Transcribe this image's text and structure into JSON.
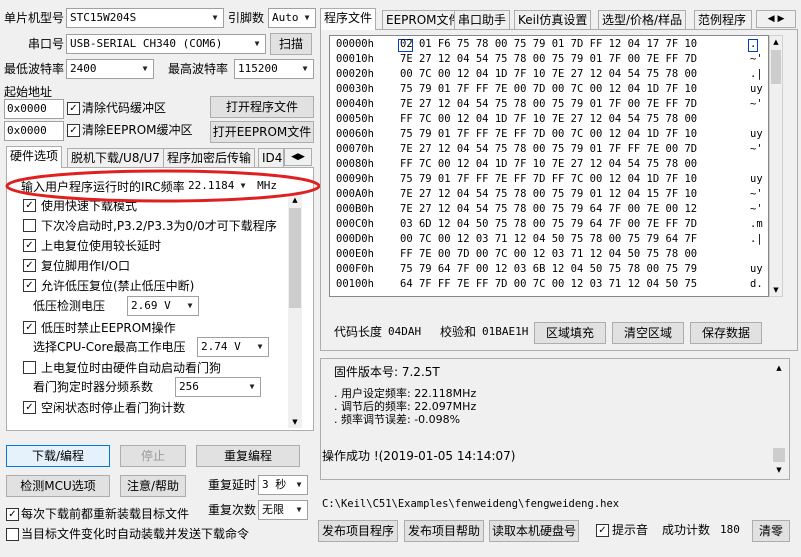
{
  "top": {
    "mcu_label": "单片机型号",
    "mcu_value": "STC15W204S",
    "pins_label": "引脚数",
    "pins_value": "Auto",
    "port_label": "串口号",
    "port_value": "USB-SERIAL CH340 (COM6)",
    "scan_button": "扫描",
    "min_baud_label": "最低波特率",
    "min_baud_value": "2400",
    "max_baud_label": "最高波特率",
    "max_baud_value": "115200",
    "start_addr_label": "起始地址",
    "addr1": "0x0000",
    "clear_code_label": "清除代码缓冲区",
    "open_prog_button": "打开程序文件",
    "addr2": "0x0000",
    "clear_eeprom_label": "清除EEPROM缓冲区",
    "open_eeprom_button": "打开EEPROM文件"
  },
  "left_tabs": [
    "硬件选项",
    "脱机下载/U8/U7",
    "程序加密后传输",
    "ID4"
  ],
  "hw": {
    "irc_label": "输入用户程序运行时的IRC频率",
    "irc_value": "22.1184",
    "irc_unit": "MHz",
    "options": [
      {
        "label": "使用快速下载模式",
        "checked": true
      },
      {
        "label": "下次冷启动时,P3.2/P3.3为0/0才可下载程序",
        "checked": false
      },
      {
        "label": "上电复位使用较长延时",
        "checked": true
      },
      {
        "label": "复位脚用作I/O口",
        "checked": true
      },
      {
        "label": "允许低压复位(禁止低压中断)",
        "checked": true
      }
    ],
    "lv_label": "低压检测电压",
    "lv_value": "2.69 V",
    "lv_disable_label": "低压时禁止EEPROM操作",
    "cpu_voltage_label": "选择CPU-Core最高工作电压",
    "cpu_voltage_value": "2.74 V",
    "wdt_label": "上电复位时由硬件自动启动看门狗",
    "wdt_div_label": "看门狗定时器分频系数",
    "wdt_div_value": "256",
    "idle_wdt_label": "空闲状态时停止看门狗计数"
  },
  "bottom_left": {
    "download_button": "下载/编程",
    "stop_button": "停止",
    "reprogram_button": "重复编程",
    "detect_button": "检测MCU选项",
    "help_button": "注意/帮助",
    "repeat_delay_label": "重复延时",
    "repeat_delay_value": "3 秒",
    "repeat_count_label": "重复次数",
    "repeat_count_value": "无限",
    "reload_label": "每次下载前都重新装载目标文件",
    "auto_reload_label": "当目标文件变化时自动装载并发送下载命令"
  },
  "right_tabs": [
    "程序文件",
    "EEPROM文件",
    "串口助手",
    "Keil仿真设置",
    "选型/价格/样品",
    "范例程序"
  ],
  "hex": {
    "rows": [
      {
        "addr": "00000h",
        "bytes": "02 01 F6 75 78 00 75 79 01 7D FF 12 04 17 7F 10",
        "ascii": "."
      },
      {
        "addr": "00010h",
        "bytes": "7E 27 12 04 54 75 78 00 75 79 01 7F 00 7E FF 7D",
        "ascii": "~'"
      },
      {
        "addr": "00020h",
        "bytes": "00 7C 00 12 04 1D 7F 10 7E 27 12 04 54 75 78 00",
        "ascii": ".|"
      },
      {
        "addr": "00030h",
        "bytes": "75 79 01 7F FF 7E 00 7D 00 7C 00 12 04 1D 7F 10",
        "ascii": "uy"
      },
      {
        "addr": "00040h",
        "bytes": "7E 27 12 04 54 75 78 00 75 79 01 7F 00 7E FF 7D",
        "ascii": "~'"
      },
      {
        "addr": "00050h",
        "bytes": "FF 7C 00 12 04 1D 7F 10 7E 27 12 04 54 75 78 00",
        "ascii": ""
      },
      {
        "addr": "00060h",
        "bytes": "75 79 01 7F FF 7E FF 7D 00 7C 00 12 04 1D 7F 10",
        "ascii": "uy"
      },
      {
        "addr": "00070h",
        "bytes": "7E 27 12 04 54 75 78 00 75 79 01 7F FF 7E 00 7D",
        "ascii": "~'"
      },
      {
        "addr": "00080h",
        "bytes": "FF 7C 00 12 04 1D 7F 10 7E 27 12 04 54 75 78 00",
        "ascii": ""
      },
      {
        "addr": "00090h",
        "bytes": "75 79 01 7F FF 7E FF 7D FF 7C 00 12 04 1D 7F 10",
        "ascii": "uy"
      },
      {
        "addr": "000A0h",
        "bytes": "7E 27 12 04 54 75 78 00 75 79 01 12 04 15 7F 10",
        "ascii": "~'"
      },
      {
        "addr": "000B0h",
        "bytes": "7E 27 12 04 54 75 78 00 75 79 64 7F 00 7E 00 12",
        "ascii": "~'"
      },
      {
        "addr": "000C0h",
        "bytes": "03 6D 12 04 50 75 78 00 75 79 64 7F 00 7E FF 7D",
        "ascii": ".m"
      },
      {
        "addr": "000D0h",
        "bytes": "00 7C 00 12 03 71 12 04 50 75 78 00 75 79 64 7F",
        "ascii": ".|"
      },
      {
        "addr": "000E0h",
        "bytes": "FF 7E 00 7D 00 7C 00 12 03 71 12 04 50 75 78 00",
        "ascii": ""
      },
      {
        "addr": "000F0h",
        "bytes": "75 79 64 7F 00 12 03 6B 12 04 50 75 78 00 75 79",
        "ascii": "uy"
      },
      {
        "addr": "00100h",
        "bytes": "64 7F FF 7E FF 7D 00 7C 00 12 03 71 12 04 50 75",
        "ascii": "d."
      }
    ]
  },
  "code_bar": {
    "len_label": "代码长度",
    "len_value": "04DAH",
    "checksum_label": "校验和",
    "checksum_value": "01BAE1H",
    "fill_button": "区域填充",
    "clear_button": "清空区域",
    "save_button": "保存数据"
  },
  "log": {
    "firmware_line": "固件版本号: 7.2.5T",
    "user_freq_line": ". 用户设定频率: 22.118MHz",
    "adjusted_freq_line": ". 调节后的频率: 22.097MHz",
    "error_line": ". 频率调节误差: -0.098%",
    "success_line": "操作成功 !(2019-01-05 14:14:07)"
  },
  "bottom_right": {
    "path": "C:\\Keil\\C51\\Examples\\fenweideng\\fengweideng.hex",
    "publish_prog_button": "发布项目程序",
    "publish_help_button": "发布项目帮助",
    "read_disk_button": "读取本机硬盘号",
    "sound_label": "提示音",
    "success_count_label": "成功计数",
    "success_count_value": "180",
    "clear_button": "清零"
  },
  "colors": {
    "highlight_ellipse": "#e02020",
    "focus_border": "#0078d7"
  }
}
